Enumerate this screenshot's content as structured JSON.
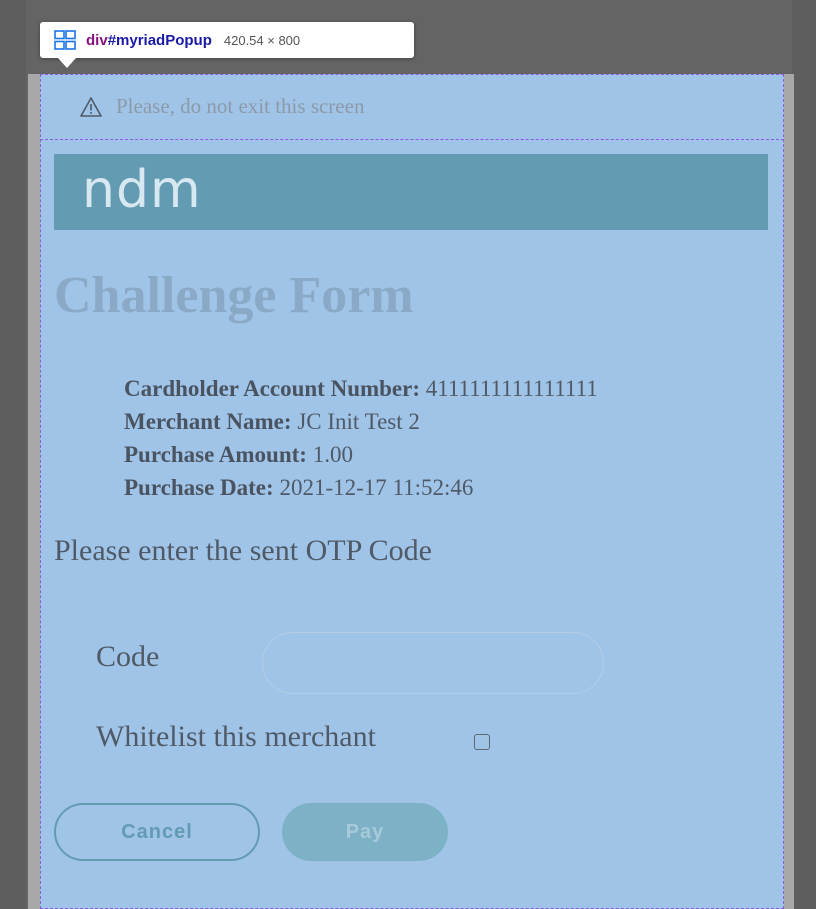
{
  "devtools": {
    "tag": "div",
    "id": "#myriadPopup",
    "size": "420.54 × 800"
  },
  "popup": {
    "warning": "Please, do not exit this screen",
    "logo": "ndm",
    "title": "Challenge Form",
    "details": [
      {
        "label": "Cardholder Account Number:",
        "value": "4111111111111111"
      },
      {
        "label": "Merchant Name:",
        "value": "JC Init Test 2"
      },
      {
        "label": "Purchase Amount:",
        "value": "1.00"
      },
      {
        "label": "Purchase Date:",
        "value": "2021-12-17 11:52:46"
      }
    ],
    "otp_prompt": "Please enter the sent OTP Code",
    "code_label": "Code",
    "code_value": "",
    "whitelist_label": "Whitelist this merchant",
    "whitelist_checked": false,
    "cancel_label": "Cancel",
    "pay_label": "Pay"
  },
  "colors": {
    "popup_bg": "#a0c4e8",
    "logo_bar": "#629bb2",
    "title": "#8aa9c6",
    "button_accent": "#629bb2"
  }
}
